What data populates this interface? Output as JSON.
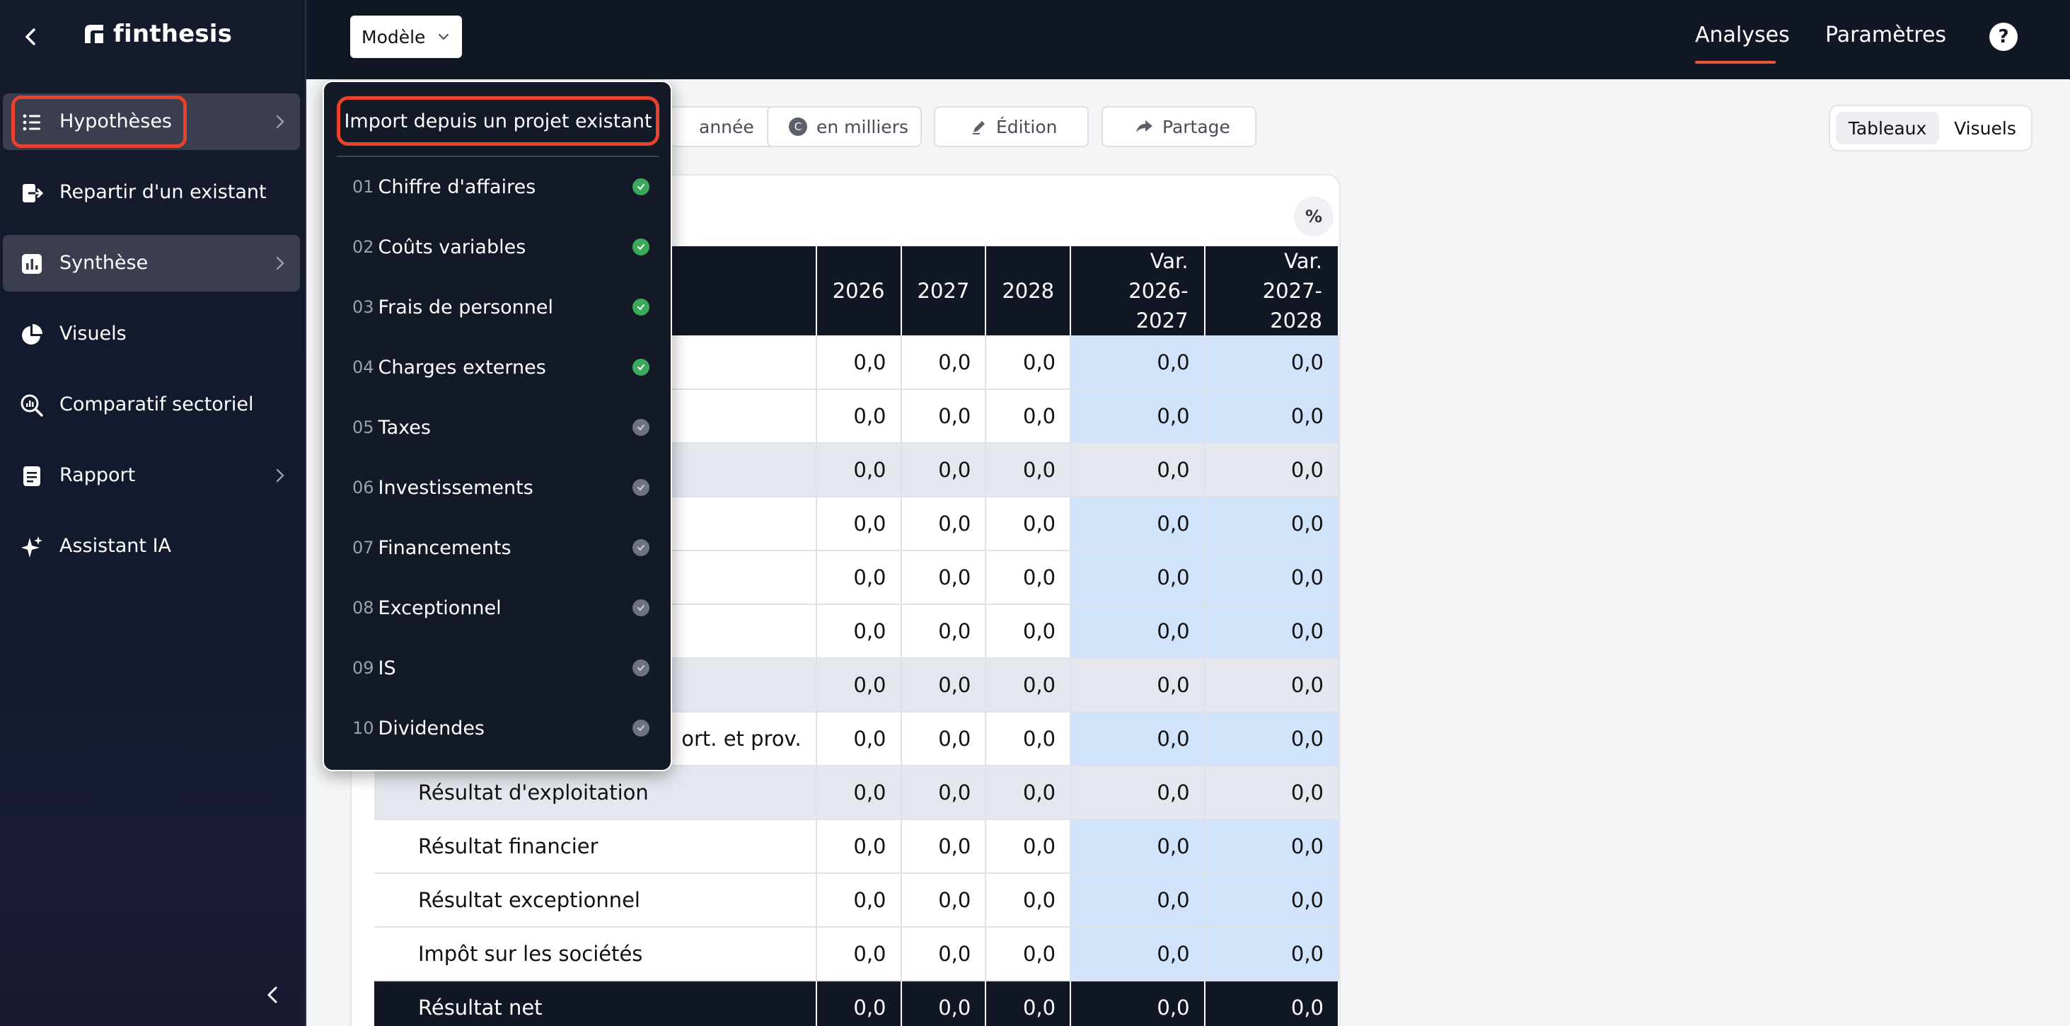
{
  "brand": {
    "name": "finthesis"
  },
  "sidebar": {
    "items": [
      {
        "label": "Hypothèses",
        "icon": "list-icon"
      },
      {
        "label": "Repartir d'un existant",
        "icon": "import-icon"
      },
      {
        "label": "Synthèse",
        "icon": "bar-chart-icon"
      },
      {
        "label": "Visuels",
        "icon": "pie-chart-icon"
      },
      {
        "label": "Comparatif sectoriel",
        "icon": "magnifier-chart-icon"
      },
      {
        "label": "Rapport",
        "icon": "document-icon"
      },
      {
        "label": "Assistant IA",
        "icon": "sparkle-icon"
      }
    ]
  },
  "topbar": {
    "model_label": "Modèle",
    "nav": [
      "Analyses",
      "Paramètres"
    ],
    "help": "?"
  },
  "toolbar": {
    "chips": [
      "année",
      "en milliers",
      "Édition",
      "Partage"
    ],
    "view_toggle": [
      "Tableaux",
      "Visuels"
    ]
  },
  "table": {
    "percent_button": "%",
    "headers": [
      "2026",
      "2027",
      "2028",
      "Var.\n2026-2027",
      "Var.\n2027-2028"
    ],
    "rows": [
      {
        "label": "",
        "values": [
          "0,0",
          "0,0",
          "0,0",
          "0,0",
          "0,0"
        ],
        "style": "normal"
      },
      {
        "label": "",
        "values": [
          "0,0",
          "0,0",
          "0,0",
          "0,0",
          "0,0"
        ],
        "style": "normal"
      },
      {
        "label": "",
        "values": [
          "0,0",
          "0,0",
          "0,0",
          "0,0",
          "0,0"
        ],
        "style": "shade"
      },
      {
        "label": "",
        "values": [
          "0,0",
          "0,0",
          "0,0",
          "0,0",
          "0,0"
        ],
        "style": "normal"
      },
      {
        "label": "",
        "values": [
          "0,0",
          "0,0",
          "0,0",
          "0,0",
          "0,0"
        ],
        "style": "normal"
      },
      {
        "label": "",
        "values": [
          "0,0",
          "0,0",
          "0,0",
          "0,0",
          "0,0"
        ],
        "style": "normal"
      },
      {
        "label": "",
        "values": [
          "0,0",
          "0,0",
          "0,0",
          "0,0",
          "0,0"
        ],
        "style": "shade"
      },
      {
        "label": "ort. et prov.",
        "values": [
          "0,0",
          "0,0",
          "0,0",
          "0,0",
          "0,0"
        ],
        "style": "normal"
      },
      {
        "label": "Résultat d'exploitation",
        "values": [
          "0,0",
          "0,0",
          "0,0",
          "0,0",
          "0,0"
        ],
        "style": "shade"
      },
      {
        "label": "Résultat financier",
        "values": [
          "0,0",
          "0,0",
          "0,0",
          "0,0",
          "0,0"
        ],
        "style": "normal"
      },
      {
        "label": "Résultat exceptionnel",
        "values": [
          "0,0",
          "0,0",
          "0,0",
          "0,0",
          "0,0"
        ],
        "style": "normal"
      },
      {
        "label": "Impôt sur les sociétés",
        "values": [
          "0,0",
          "0,0",
          "0,0",
          "0,0",
          "0,0"
        ],
        "style": "normal"
      },
      {
        "label": "Résultat net",
        "values": [
          "0,0",
          "0,0",
          "0,0",
          "0,0",
          "0,0"
        ],
        "style": "dark"
      }
    ]
  },
  "dropdown": {
    "import_label": "Import depuis un projet existant",
    "items": [
      {
        "num": "01",
        "label": "Chiffre d'affaires",
        "done": true
      },
      {
        "num": "02",
        "label": "Coûts variables",
        "done": true
      },
      {
        "num": "03",
        "label": "Frais de personnel",
        "done": true
      },
      {
        "num": "04",
        "label": "Charges externes",
        "done": true
      },
      {
        "num": "05",
        "label": "Taxes",
        "done": false
      },
      {
        "num": "06",
        "label": "Investissements",
        "done": false
      },
      {
        "num": "07",
        "label": "Financements",
        "done": false
      },
      {
        "num": "08",
        "label": "Exceptionnel",
        "done": false
      },
      {
        "num": "09",
        "label": "IS",
        "done": false
      },
      {
        "num": "10",
        "label": "Dividendes",
        "done": false
      }
    ]
  },
  "colors": {
    "accent": "#e8422c",
    "dark": "#121726",
    "variation_fill": "#d0e3fb",
    "done": "#3aa95b"
  }
}
